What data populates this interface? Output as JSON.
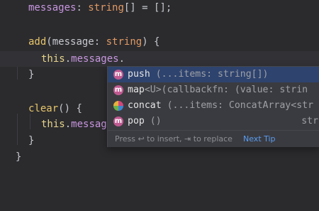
{
  "code": {
    "line1": {
      "prop": "messages",
      "colon": ": ",
      "type": "string",
      "rest": "[] = [];"
    },
    "line2": {
      "fn": "add",
      "open": "(",
      "param": "message",
      "colon": ": ",
      "type": "string",
      "close": ") {"
    },
    "line3": {
      "kw": "this",
      "dot": ".",
      "prop": "messages",
      "dot2": "."
    },
    "line4": {
      "brace": "}"
    },
    "line5": {
      "fn": "clear",
      "rest": "() {"
    },
    "line6": {
      "kw": "this",
      "dot": ".",
      "prop": "messag"
    },
    "line7": {
      "brace": "}"
    },
    "line8": {
      "brace": "}"
    }
  },
  "completion": {
    "items": [
      {
        "icon": "m",
        "name": "push",
        "signature": " (...items: string[])",
        "right": ""
      },
      {
        "icon": "m",
        "name": "map",
        "signature": "<U>(callbackfn: (value: strin",
        "right": ""
      },
      {
        "icon": "",
        "name": "concat",
        "signature": " (...items: ConcatArray<str",
        "right": ""
      },
      {
        "icon": "m",
        "name": "pop",
        "signature": " ()",
        "right": "stri"
      }
    ],
    "hint": "Press ↩ to insert, ⇥ to replace",
    "next_tip": "Next Tip"
  },
  "colors": {
    "background": "#2b2b2e",
    "selection": "#2e436e",
    "method_icon": "#bf5a91",
    "link": "#5a9cf0"
  }
}
